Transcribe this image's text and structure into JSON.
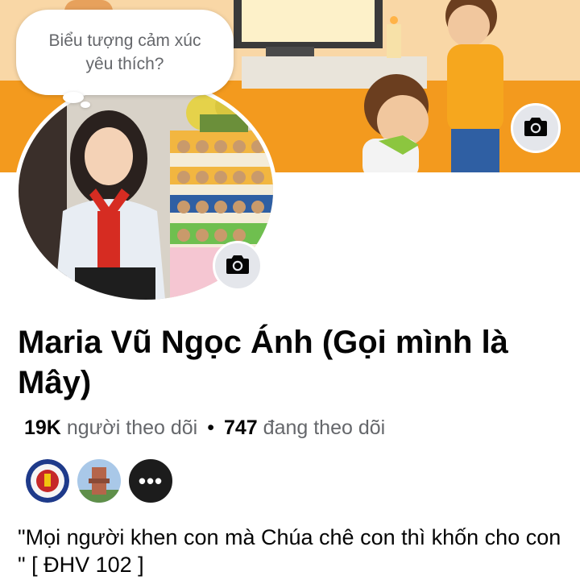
{
  "bubble": {
    "text": "Biểu tượng cảm xúc yêu thích?"
  },
  "profile": {
    "name": "Maria Vũ Ngọc Ánh (Gọi mình là Mây)",
    "followers_count": "19K",
    "followers_label": "người theo dõi",
    "separator": "•",
    "following_count": "747",
    "following_label": "đang theo dõi",
    "mutuals_more": "•••",
    "bio": "\"Mọi người khen con mà Chúa chê con thì khốn cho con \"  [ ĐHV 102 ]"
  },
  "icons": [
    "camera-icon",
    "camera-icon"
  ],
  "colors": {
    "accent_orange": "#f5a623",
    "button_gray": "#e4e6eb",
    "secondary_text": "#65676b"
  }
}
